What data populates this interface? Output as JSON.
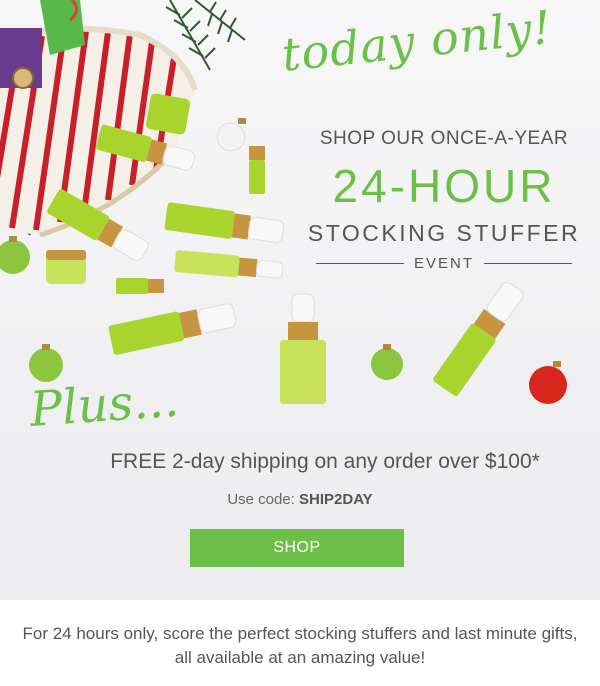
{
  "hero": {
    "headline_script": "today only!",
    "line1": "SHOP OUR ONCE-A-YEAR",
    "line2": "24-HOUR",
    "line3": "STOCKING STUFFER",
    "line4": "EVENT",
    "plus_script": "Plus...",
    "shipping_text": "FREE 2-day shipping on any order over $100*",
    "code_label": "Use code:",
    "code_value": "SHIP2DAY",
    "shop_button": "SHOP"
  },
  "footer": {
    "text": "For 24 hours only, score the perfect stocking stuffers and last minute gifts, all available at an amazing value!"
  },
  "colors": {
    "accent_green": "#6cc04a",
    "text_gray": "#555555",
    "ornament_red": "#d7261b",
    "stripe_red": "#c8202a"
  },
  "icons": [
    "christmas-pouch",
    "pine-branch",
    "ornament-icon",
    "product-bottle",
    "product-jar"
  ]
}
